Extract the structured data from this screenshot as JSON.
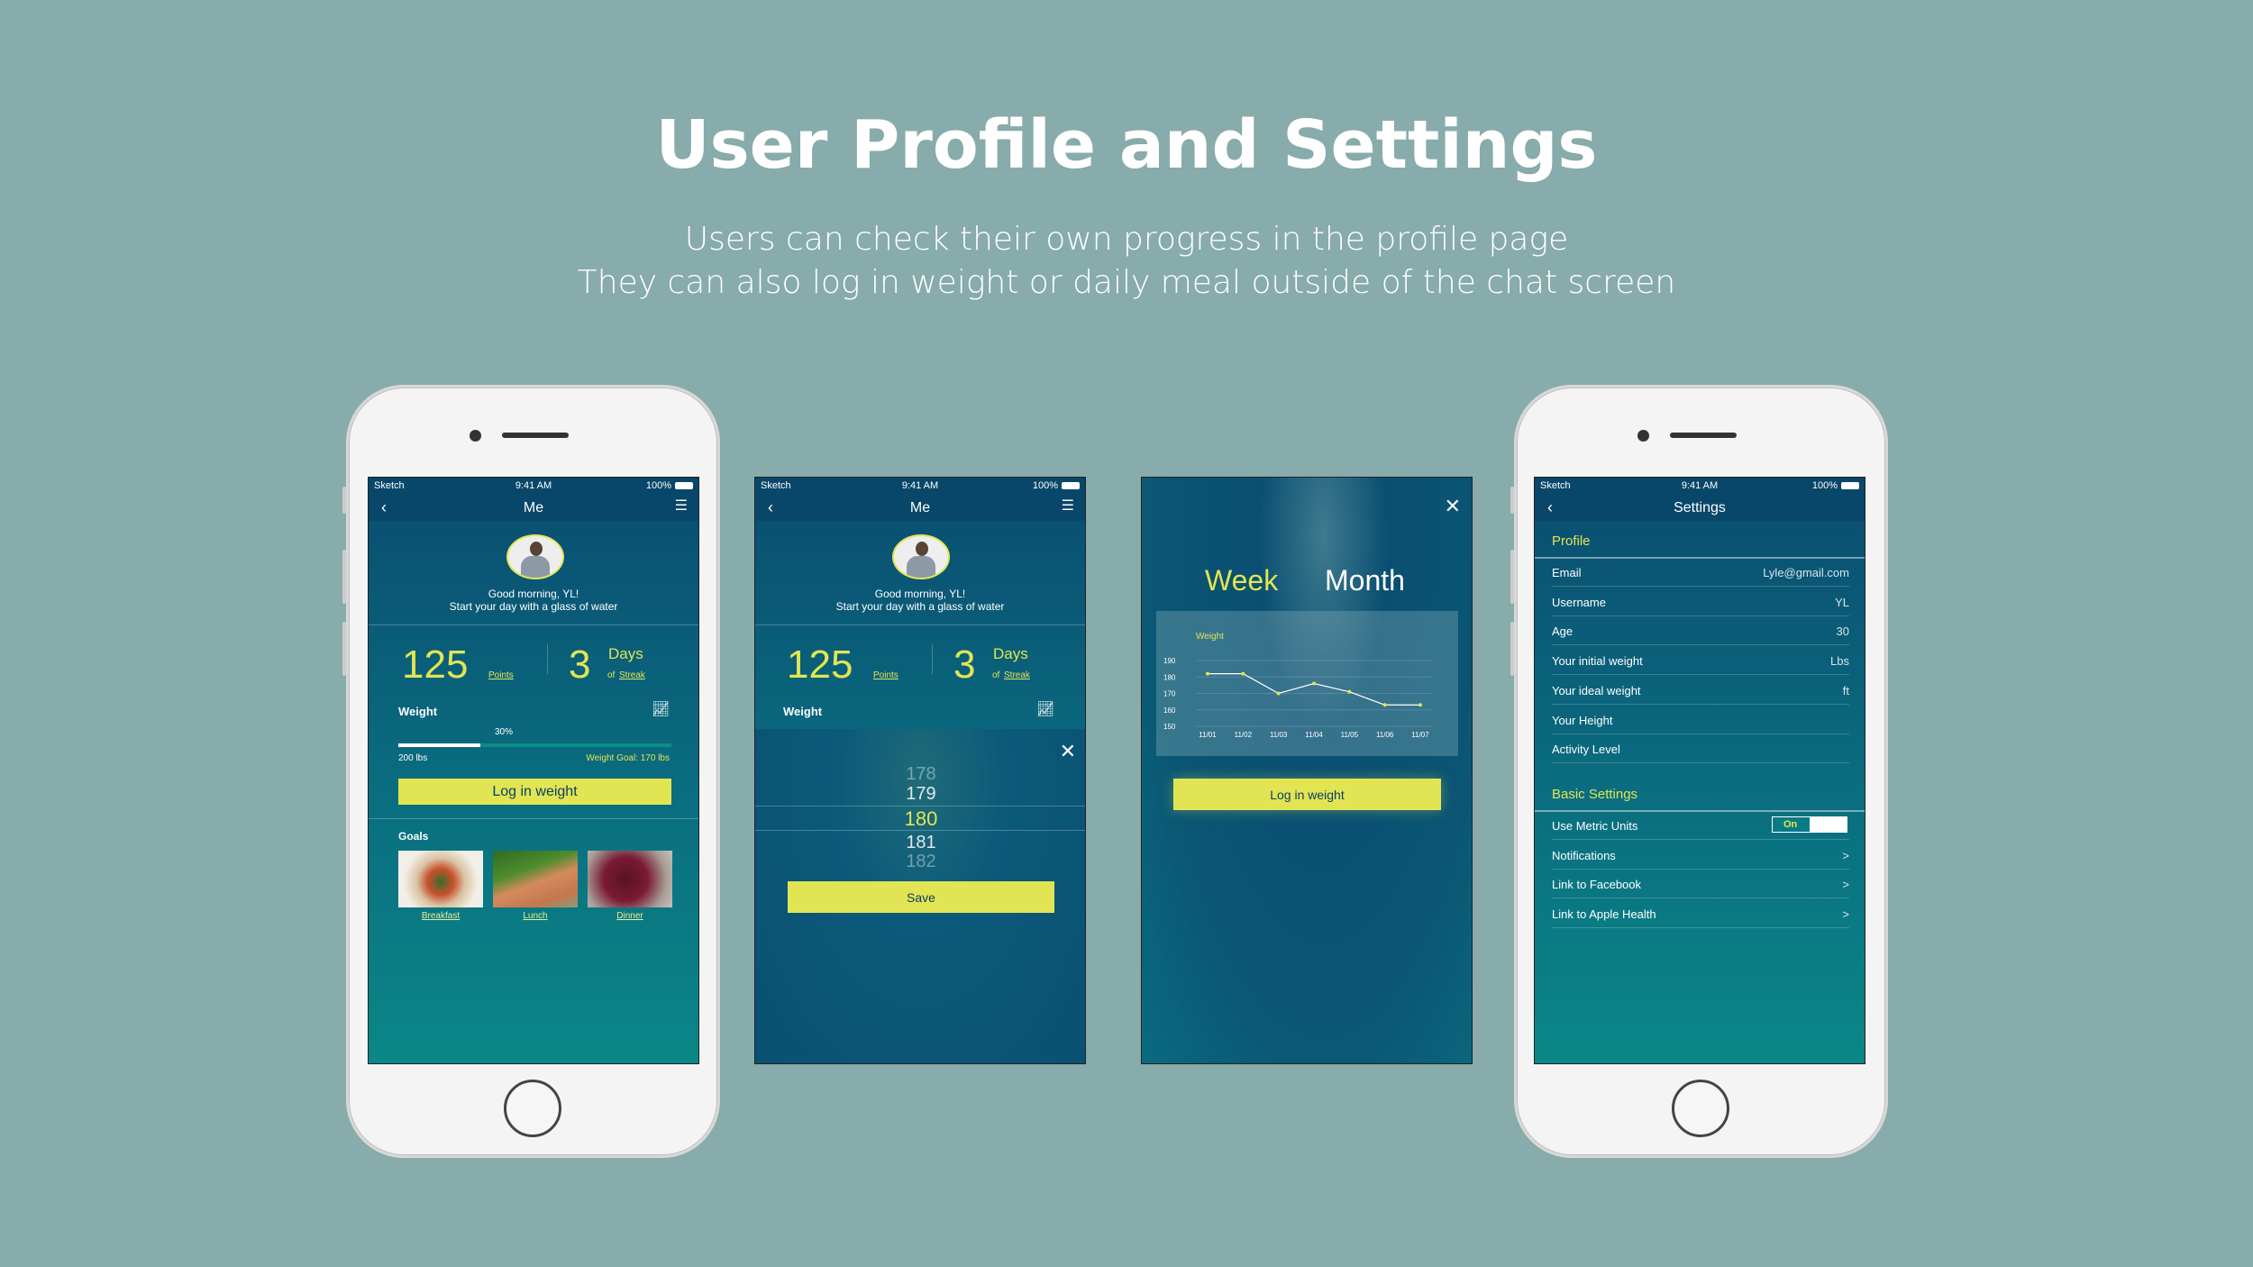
{
  "title": "User Profile and Settings",
  "subtitle": [
    "Users can check their own progress in the profile page",
    "They can also log in weight or daily meal outside of the chat screen"
  ],
  "status": {
    "carrier": "Sketch",
    "time": "9:41 AM",
    "battery": "100%"
  },
  "profile": {
    "nav_title": "Me",
    "greeting": "Good morning, YL!",
    "tip": "Start your day with a glass of water",
    "points": "125",
    "points_label": "Points",
    "streak": "3",
    "streak_unit": "Days",
    "streak_of": "of",
    "streak_label": "Streak",
    "weight_label": "Weight",
    "progress_percent": 30,
    "progress_label": "30%",
    "current_weight": "200 lbs",
    "goal_label": "Weight Goal:  170 lbs",
    "log_button": "Log in weight",
    "goals_label": "Goals",
    "meals": [
      "Breakfast",
      "Lunch",
      "Dinner"
    ]
  },
  "picker": {
    "values": [
      "178",
      "179",
      "180",
      "181",
      "182"
    ],
    "selected": "180",
    "save_button": "Save"
  },
  "chart_screen": {
    "tabs": [
      "Week",
      "Month"
    ],
    "active_tab": "Week",
    "log_button": "Log in weight"
  },
  "chart_data": {
    "type": "line",
    "title": "Weight",
    "categories": [
      "11/01",
      "11/02",
      "11/03",
      "11/04",
      "11/05",
      "11/06",
      "11/07"
    ],
    "values": [
      182,
      182,
      170,
      176,
      171,
      163,
      163
    ],
    "yticks": [
      "150",
      "160",
      "170",
      "180",
      "190"
    ],
    "ylim": [
      150,
      190
    ],
    "grid": true,
    "line_color": "#ffffff",
    "marker_color": "#e2e553"
  },
  "settings": {
    "nav_title": "Settings",
    "profile_header": "Profile",
    "profile_rows": [
      {
        "label": "Email",
        "value": "Lyle@gmail.com"
      },
      {
        "label": "Username",
        "value": "YL"
      },
      {
        "label": "Age",
        "value": "30"
      },
      {
        "label": "Your initial weight",
        "value": "Lbs"
      },
      {
        "label": "Your ideal weight",
        "value": "ft"
      },
      {
        "label": "Your Height",
        "value": ""
      },
      {
        "label": "Activity Level",
        "value": ""
      }
    ],
    "basic_header": "Basic Settings",
    "metric_label": "Use Metric Units",
    "metric_toggle": "On",
    "links": [
      {
        "label": "Notifications",
        "chevron": ">"
      },
      {
        "label": "Link to Facebook",
        "chevron": ">"
      },
      {
        "label": "Link to Apple Health",
        "chevron": ">"
      }
    ]
  },
  "colors": {
    "accent": "#e2e553",
    "background": "#88abab",
    "screen_top": "#0a4c70",
    "screen_bottom": "#0a8787"
  }
}
